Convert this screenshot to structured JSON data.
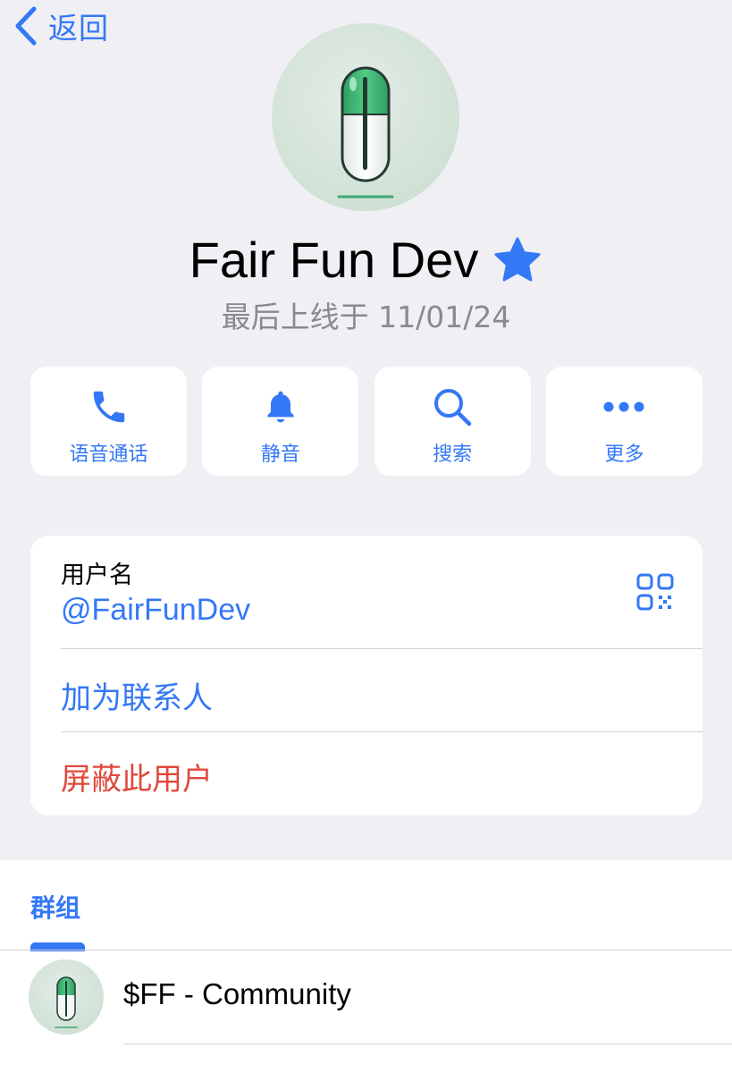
{
  "nav": {
    "back_label": "返回",
    "back_icon": "chevron-left-icon"
  },
  "profile": {
    "name": "Fair Fun Dev",
    "badge_icon": "star-icon",
    "last_seen": "最后上线于 11/01/24",
    "avatar_icon": "pill-icon"
  },
  "actions": [
    {
      "label": "语音通话",
      "icon": "phone-icon"
    },
    {
      "label": "静音",
      "icon": "bell-icon"
    },
    {
      "label": "搜索",
      "icon": "search-icon"
    },
    {
      "label": "更多",
      "icon": "more-icon"
    }
  ],
  "info": {
    "username_label": "用户名",
    "username_value": "@FairFunDev",
    "qr_icon": "qr-code-icon",
    "add_contact_label": "加为联系人",
    "block_user_label": "屏蔽此用户"
  },
  "groups": {
    "tab_label": "群组",
    "items": [
      {
        "name": "$FF - Community",
        "avatar_icon": "pill-icon"
      }
    ]
  },
  "colors": {
    "accent": "#3478f6",
    "destructive": "#e0483b",
    "background": "#efeff4",
    "secondary_text": "#8a8a8e"
  }
}
